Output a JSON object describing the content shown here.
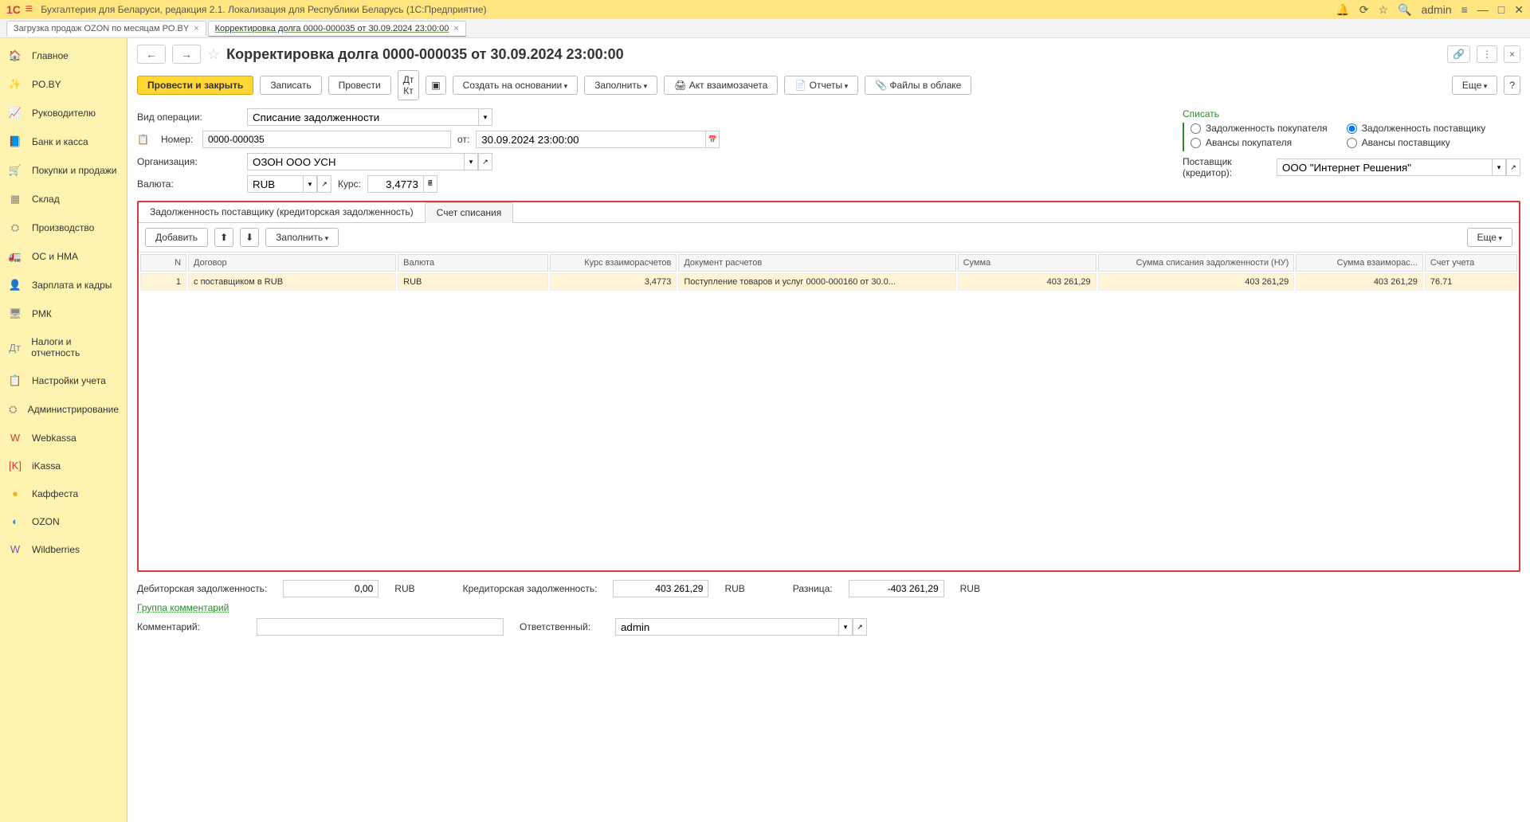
{
  "titlebar": {
    "logo": "1C",
    "title": "Бухгалтерия для Беларуси, редакция 2.1. Локализация для Республики Беларусь   (1С:Предприятие)",
    "user": "admin"
  },
  "tabs": [
    {
      "label": "Загрузка продаж OZON по месяцам PO.BY"
    },
    {
      "label": "Корректировка долга 0000-000035 от 30.09.2024 23:00:00",
      "active": true
    }
  ],
  "sidebar": [
    {
      "icon": "🏠",
      "label": "Главное"
    },
    {
      "icon": "✨",
      "label": "PO.BY",
      "cls": "red"
    },
    {
      "icon": "📈",
      "label": "Руководителю"
    },
    {
      "icon": "📘",
      "label": "Банк и касса"
    },
    {
      "icon": "🛒",
      "label": "Покупки и продажи"
    },
    {
      "icon": "▦",
      "label": "Склад"
    },
    {
      "icon": "⛭",
      "label": "Производство"
    },
    {
      "icon": "🚛",
      "label": "ОС и НМА"
    },
    {
      "icon": "👤",
      "label": "Зарплата и кадры"
    },
    {
      "icon": "🖥",
      "label": "РМК"
    },
    {
      "icon": "Дт",
      "label": "Налоги и отчетность"
    },
    {
      "icon": "📋",
      "label": "Настройки учета"
    },
    {
      "icon": "⛭",
      "label": "Администрирование"
    },
    {
      "icon": "W",
      "label": "Webkassa",
      "cls": "red"
    },
    {
      "icon": "[K]",
      "label": "iKassa",
      "cls": "red"
    },
    {
      "icon": "●",
      "label": "Каффеста",
      "cls": "yellow"
    },
    {
      "icon": "◐",
      "label": "OZON",
      "cls": "blue"
    },
    {
      "icon": "W",
      "label": "Wildberries",
      "cls": "purple"
    }
  ],
  "page": {
    "title": "Корректировка долга 0000-000035 от 30.09.2024 23:00:00"
  },
  "toolbar": {
    "post_close": "Провести и закрыть",
    "write": "Записать",
    "post": "Провести",
    "create_base": "Создать на основании",
    "fill": "Заполнить",
    "act": "Акт взаимозачета",
    "reports": "Отчеты",
    "cloud": "Файлы в облаке",
    "more": "Еще"
  },
  "form": {
    "op_type_label": "Вид операции:",
    "op_type": "Списание задолженности",
    "num_label": "Номер:",
    "num": "0000-000035",
    "from": "от:",
    "date": "30.09.2024 23:00:00",
    "org_label": "Организация:",
    "org": "ОЗОН ООО УСН",
    "curr_label": "Валюта:",
    "curr": "RUB",
    "rate_label": "Курс:",
    "rate": "3,4773",
    "writeoff": "Списать",
    "r1": "Задолженность покупателя",
    "r2": "Задолженность поставщику",
    "r3": "Авансы покупателя",
    "r4": "Авансы поставщику",
    "sup_label": "Поставщик (кредитор):",
    "sup": "ООО \"Интернет Решения\""
  },
  "tabbox": {
    "t1": "Задолженность поставщику (кредиторская задолженность)",
    "t2": "Счет списания",
    "add": "Добавить",
    "fill": "Заполнить",
    "more": "Еще"
  },
  "grid": {
    "headers": {
      "n": "N",
      "contract": "Договор",
      "curr": "Валюта",
      "rate": "Курс взаиморасчетов",
      "doc": "Документ расчетов",
      "amount": "Сумма",
      "writeoff_nu": "Сумма списания задолженности (НУ)",
      "mutual": "Сумма взаиморас...",
      "acct": "Счет учета"
    },
    "rows": [
      {
        "n": "1",
        "contract": "с поставщиком в RUB",
        "curr": "RUB",
        "rate": "3,4773",
        "doc": "Поступление товаров и услуг 0000-000160 от 30.0...",
        "amount": "403 261,29",
        "writeoff_nu": "403 261,29",
        "mutual": "403 261,29",
        "acct": "76.71"
      }
    ]
  },
  "footer": {
    "deb_label": "Дебиторская задолженность:",
    "deb": "0,00",
    "deb_c": "RUB",
    "cred_label": "Кредиторская задолженность:",
    "cred": "403 261,29",
    "cred_c": "RUB",
    "diff_label": "Разница:",
    "diff": "-403 261,29",
    "diff_c": "RUB",
    "group_comment": "Группа комментарий",
    "comment_label": "Комментарий:",
    "resp_label": "Ответственный:",
    "resp": "admin"
  }
}
